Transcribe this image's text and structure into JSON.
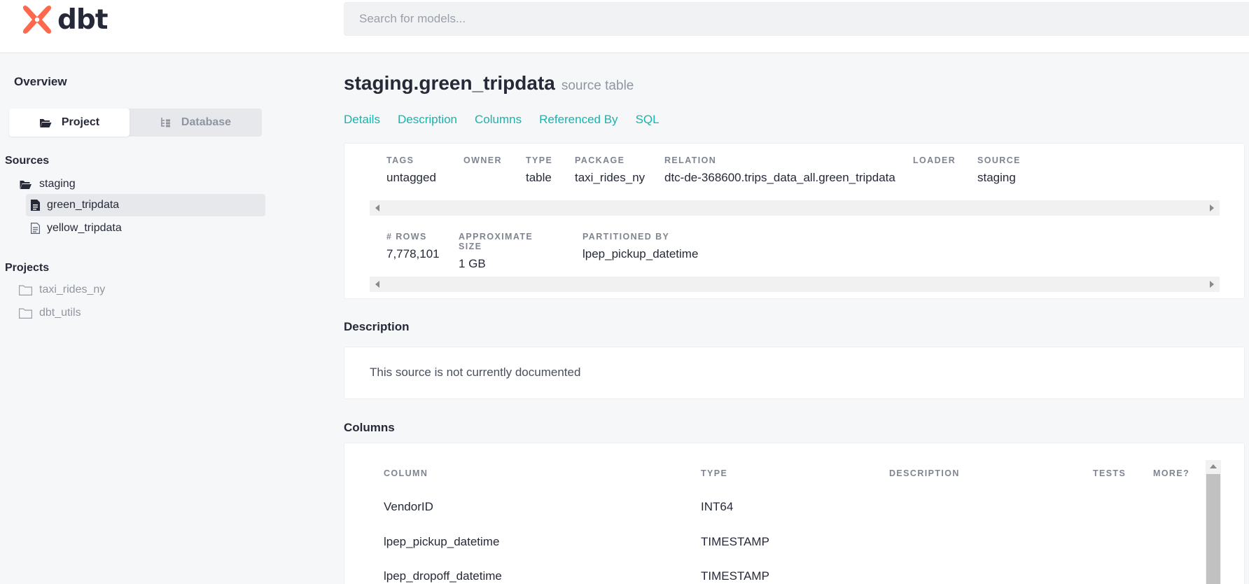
{
  "header": {
    "logo_text": "dbt",
    "search_placeholder": "Search for models..."
  },
  "sidebar": {
    "overview_label": "Overview",
    "toggle": {
      "project_label": "Project",
      "database_label": "Database",
      "active": "Project"
    },
    "sources_label": "Sources",
    "sources": [
      {
        "label": "staging",
        "icon": "folder-open-icon",
        "children": [
          {
            "label": "green_tripdata",
            "icon": "file-icon",
            "selected": true
          },
          {
            "label": "yellow_tripdata",
            "icon": "file-outline-icon",
            "selected": false
          }
        ]
      }
    ],
    "projects_label": "Projects",
    "projects": [
      {
        "label": "taxi_rides_ny",
        "icon": "folder-icon"
      },
      {
        "label": "dbt_utils",
        "icon": "folder-icon"
      }
    ]
  },
  "main": {
    "title": "staging.green_tripdata",
    "subtitle": "source table",
    "tabs": [
      "Details",
      "Description",
      "Columns",
      "Referenced By",
      "SQL"
    ],
    "details": {
      "row1": [
        {
          "label": "TAGS",
          "value": "untagged"
        },
        {
          "label": "OWNER",
          "value": ""
        },
        {
          "label": "TYPE",
          "value": "table"
        },
        {
          "label": "PACKAGE",
          "value": "taxi_rides_ny"
        },
        {
          "label": "RELATION",
          "value": "dtc-de-368600.trips_data_all.green_tripdata"
        },
        {
          "label": "LOADER",
          "value": ""
        },
        {
          "label": "SOURCE",
          "value": "staging"
        }
      ],
      "row2": [
        {
          "label": "# ROWS",
          "value": "7,778,101"
        },
        {
          "label": "APPROXIMATE SIZE",
          "value": "1 GB"
        },
        {
          "label": "PARTITIONED BY",
          "value": "lpep_pickup_datetime"
        }
      ]
    },
    "description_title": "Description",
    "description_text": "This source is not currently documented",
    "columns_title": "Columns",
    "columns_table": {
      "headers": [
        "COLUMN",
        "TYPE",
        "DESCRIPTION",
        "TESTS",
        "MORE?"
      ],
      "rows": [
        {
          "column": "VendorID",
          "type": "INT64"
        },
        {
          "column": "lpep_pickup_datetime",
          "type": "TIMESTAMP"
        },
        {
          "column": "lpep_dropoff_datetime",
          "type": "TIMESTAMP"
        }
      ]
    }
  },
  "colors": {
    "accent": "#1ab3ad",
    "logo": "#ff694b",
    "text": "#262a38"
  }
}
